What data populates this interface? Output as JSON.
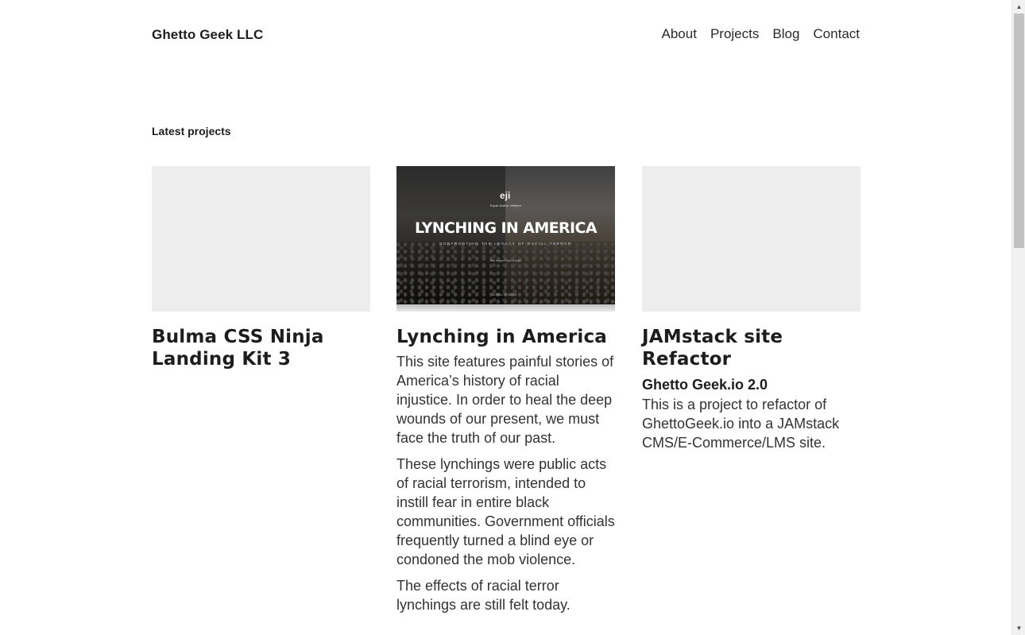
{
  "header": {
    "brand": "Ghetto Geek LLC",
    "nav": [
      "About",
      "Projects",
      "Blog",
      "Contact"
    ]
  },
  "section": {
    "title": "Latest projects"
  },
  "projects": [
    {
      "title": "Bulma CSS Ninja Landing Kit 3",
      "subtitle": "",
      "paragraphs": [],
      "image": "placeholder"
    },
    {
      "title": "Lynching in America",
      "subtitle": "",
      "image": "photo",
      "image_text": {
        "logo": "eji",
        "org": "Equal Justice Initiative",
        "headline": "LYNCHING IN AMERICA",
        "sub": "CONFRONTING THE LEGACY OF RACIAL TERROR",
        "tiny": "with support from Google",
        "scroll": "SCROLL TO BEGIN"
      },
      "paragraphs": [
        "This site features painful stories of America’s history of racial injustice. In order to heal the deep wounds of our present, we must face the truth of our past.",
        "These lynchings were public acts of racial terrorism, intended to instill fear in entire black communities. Government officials frequently turned a blind eye or condoned the mob violence.",
        "The effects of racial terror lynchings are still felt today."
      ]
    },
    {
      "title": "JAMstack site Refactor",
      "subtitle": "Ghetto Geek.io 2.0",
      "paragraphs": [
        "This is a project to refactor of GhettoGeek.io into a JAMstack CMS/E-Commerce/LMS site."
      ],
      "image": "placeholder"
    }
  ],
  "scrollbar": {
    "up_icon": "triangle-up-icon",
    "down_icon": "triangle-down-icon"
  }
}
